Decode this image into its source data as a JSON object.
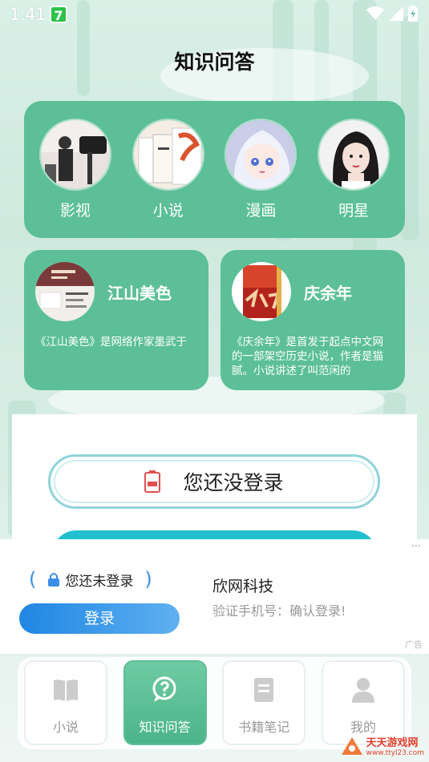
{
  "status_bar": {
    "time": "1:41",
    "app_badge": "7"
  },
  "page_title": "知识问答",
  "categories": [
    {
      "label": "影视",
      "icon": "film-camera-photo"
    },
    {
      "label": "小说",
      "icon": "books-photo"
    },
    {
      "label": "漫画",
      "icon": "anime-girl-photo"
    },
    {
      "label": "明星",
      "icon": "celebrity-photo"
    }
  ],
  "books": [
    {
      "title": "江山美色",
      "description": "《江山美色》是网络作家墨武于"
    },
    {
      "title": "庆余年",
      "description": "《庆余年》是首发于起点中文网的一部架空历史小说，作者是猫腻。小说讲述了叫范闲的"
    }
  ],
  "login_prompt": {
    "label": "您还没登录"
  },
  "ad": {
    "more": "···",
    "status_text": "您还未登录",
    "login_button": "登录",
    "company": "欣网科技",
    "subtitle": "验证手机号：确认登录!",
    "tag": "广告"
  },
  "tabs": [
    {
      "label": "小说",
      "icon": "book-icon",
      "active": false
    },
    {
      "label": "知识问答",
      "icon": "question-bubble-icon",
      "active": true
    },
    {
      "label": "书籍笔记",
      "icon": "note-icon",
      "active": false
    },
    {
      "label": "我的",
      "icon": "person-icon",
      "active": false
    }
  ],
  "watermark": {
    "name": "天天游戏网",
    "url": "www.ttyl23.com"
  },
  "colors": {
    "accent": "#5cbf97",
    "ad_button": "#1f86e3",
    "teal": "#22bfcf"
  }
}
